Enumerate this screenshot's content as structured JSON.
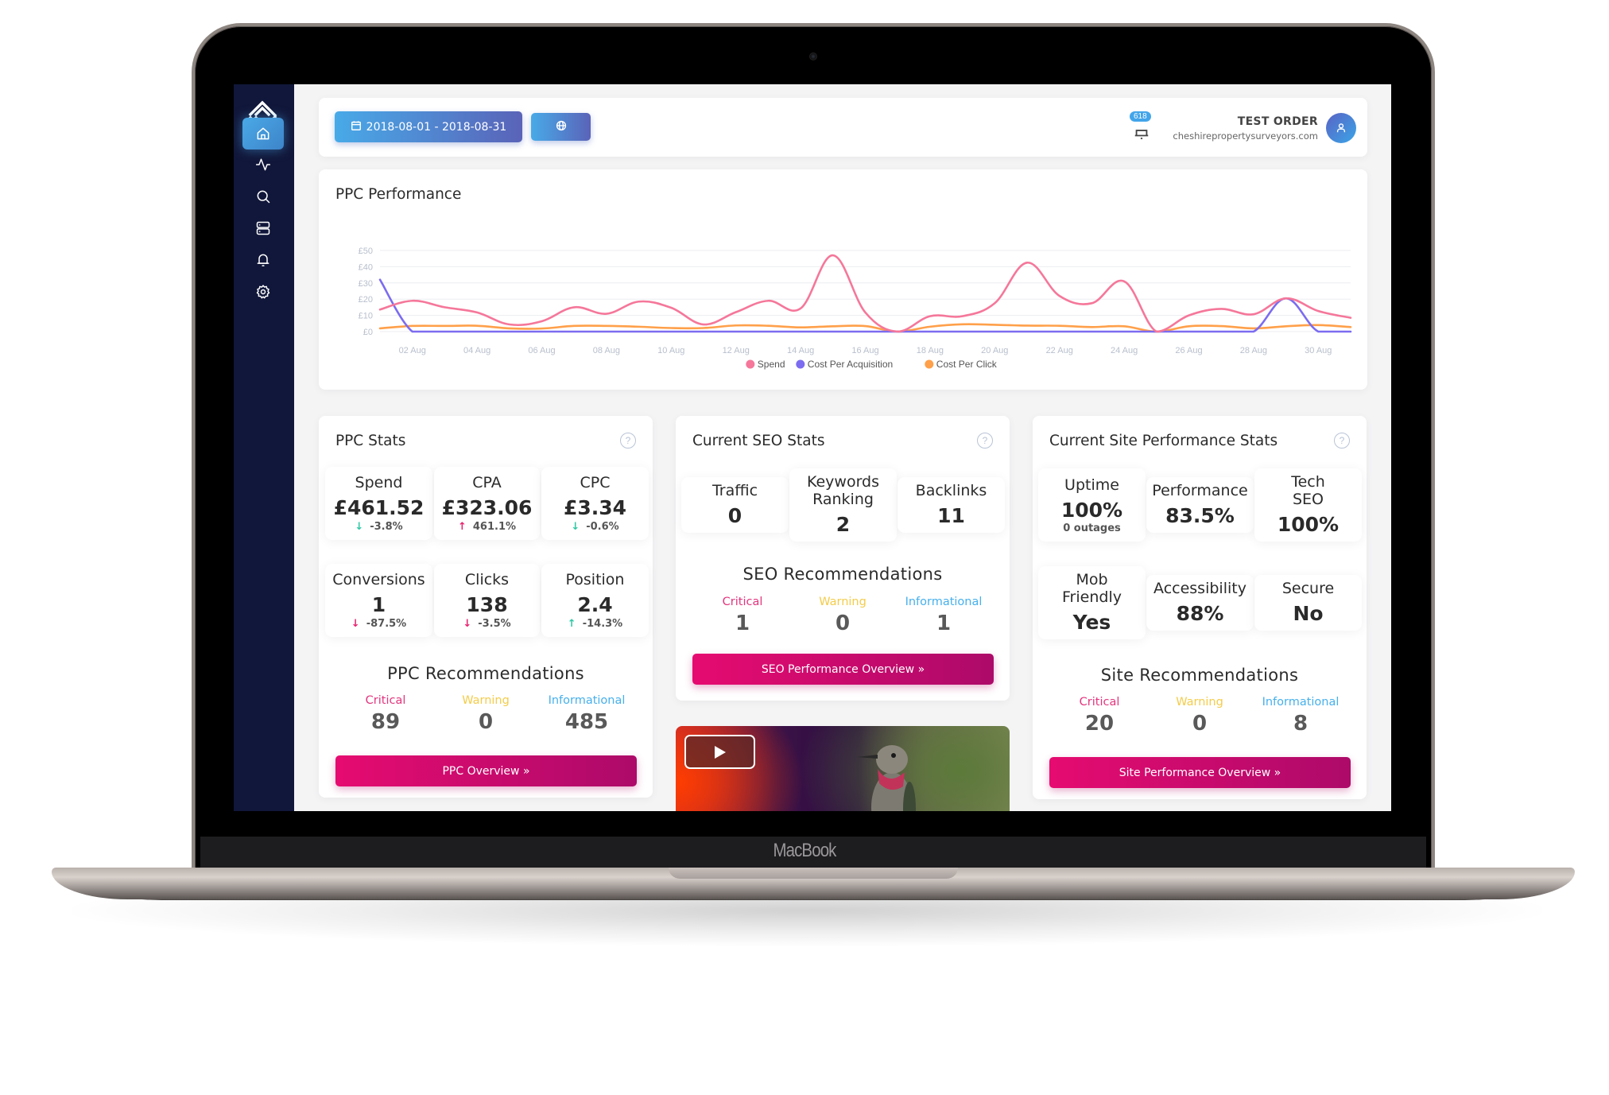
{
  "device": {
    "brand_label": "MacBook"
  },
  "sidebar": {
    "logo": "brand-logo",
    "items": [
      {
        "name": "home",
        "icon": "home-icon",
        "active": true
      },
      {
        "name": "activity",
        "icon": "activity-icon",
        "active": false
      },
      {
        "name": "search",
        "icon": "search-icon",
        "active": false
      },
      {
        "name": "servers",
        "icon": "server-icon",
        "active": false
      },
      {
        "name": "notifications",
        "icon": "bell-icon",
        "active": false
      },
      {
        "name": "settings",
        "icon": "gear-icon",
        "active": false
      }
    ]
  },
  "header": {
    "date_range": "2018-08-01 - 2018-08-31",
    "date_icon": "calendar-icon",
    "globe_icon": "globe-icon",
    "notification_count": "618",
    "user_name": "TEST ORDER",
    "user_site": "cheshirepropertysurveyors.com",
    "avatar_icon": "user-icon"
  },
  "chart_data": {
    "type": "line",
    "title": "PPC Performance",
    "xlabel": "",
    "ylabel": "",
    "x": [
      "01 Aug",
      "02 Aug",
      "03 Aug",
      "04 Aug",
      "05 Aug",
      "06 Aug",
      "07 Aug",
      "08 Aug",
      "09 Aug",
      "10 Aug",
      "11 Aug",
      "12 Aug",
      "13 Aug",
      "14 Aug",
      "15 Aug",
      "16 Aug",
      "17 Aug",
      "18 Aug",
      "19 Aug",
      "20 Aug",
      "21 Aug",
      "22 Aug",
      "23 Aug",
      "24 Aug",
      "25 Aug",
      "26 Aug",
      "27 Aug",
      "28 Aug",
      "29 Aug",
      "30 Aug",
      "31 Aug"
    ],
    "x_tick_labels": [
      "02 Aug",
      "04 Aug",
      "06 Aug",
      "08 Aug",
      "10 Aug",
      "12 Aug",
      "14 Aug",
      "16 Aug",
      "18 Aug",
      "20 Aug",
      "22 Aug",
      "24 Aug",
      "26 Aug",
      "28 Aug",
      "30 Aug"
    ],
    "y_tick_labels": [
      "£0",
      "£10",
      "£20",
      "£30",
      "£40",
      "£50"
    ],
    "ylim": [
      0,
      50
    ],
    "grid": true,
    "legend_position": "bottom-center",
    "series": [
      {
        "name": "Spend",
        "color": "#f5779a",
        "values": [
          13.6,
          19,
          15,
          11.8,
          4.4,
          6.4,
          15,
          11,
          18.5,
          14.7,
          4.4,
          12,
          19,
          14.3,
          47,
          11.8,
          0,
          9.5,
          9.5,
          17.5,
          42.5,
          22,
          17.5,
          31,
          0,
          10,
          14,
          10.7,
          20.5,
          12.7,
          8.5
        ]
      },
      {
        "name": "Cost Per Acquisition",
        "color": "#7b6cf0",
        "values": [
          32,
          0,
          0,
          0,
          0,
          0,
          0,
          0,
          0,
          0,
          0,
          0,
          0,
          0,
          0,
          0,
          0,
          0,
          0,
          0,
          0,
          0,
          0,
          0,
          0,
          0,
          0,
          0,
          20.5,
          0,
          0
        ]
      },
      {
        "name": "Cost Per Click",
        "color": "#ffa04a",
        "values": [
          2,
          3.5,
          3.5,
          3.6,
          2,
          1.9,
          3.5,
          3.5,
          3,
          2.2,
          2.2,
          3.8,
          3.6,
          2.6,
          3.3,
          3.4,
          0,
          3,
          4.5,
          4.2,
          3.7,
          3.6,
          2.8,
          3.3,
          0,
          3.3,
          3.4,
          2,
          3.3,
          4,
          2.8
        ]
      }
    ]
  },
  "ppc_stats": {
    "title": "PPC Stats",
    "help_icon": "?",
    "tiles": [
      {
        "label": "Spend",
        "value": "£461.52",
        "change": "-3.8%",
        "direction": "down",
        "sentiment": "good"
      },
      {
        "label": "CPA",
        "value": "£323.06",
        "change": "461.1%",
        "direction": "up",
        "sentiment": "bad"
      },
      {
        "label": "CPC",
        "value": "£3.34",
        "change": "-0.6%",
        "direction": "down",
        "sentiment": "good"
      },
      {
        "label": "Conversions",
        "value": "1",
        "change": "-87.5%",
        "direction": "down",
        "sentiment": "bad"
      },
      {
        "label": "Clicks",
        "value": "138",
        "change": "-3.5%",
        "direction": "down",
        "sentiment": "bad"
      },
      {
        "label": "Position",
        "value": "2.4",
        "change": "-14.3%",
        "direction": "up",
        "sentiment": "good"
      }
    ],
    "recommendations": {
      "title": "PPC Recommendations",
      "critical_label": "Critical",
      "critical": "89",
      "warning_label": "Warning",
      "warning": "0",
      "info_label": "Informational",
      "info": "485"
    },
    "cta": "PPC Overview  »"
  },
  "seo_stats": {
    "title": "Current SEO Stats",
    "help_icon": "?",
    "tiles": [
      {
        "label": "Traffic",
        "value": "0"
      },
      {
        "label": "Keywords Ranking",
        "value": "2"
      },
      {
        "label": "Backlinks",
        "value": "11"
      }
    ],
    "recommendations": {
      "title": "SEO Recommendations",
      "critical_label": "Critical",
      "critical": "1",
      "warning_label": "Warning",
      "warning": "0",
      "info_label": "Informational",
      "info": "1"
    },
    "cta": "SEO Performance Overview  »"
  },
  "site_stats": {
    "title": "Current Site Performance Stats",
    "help_icon": "?",
    "tiles": [
      {
        "label": "Uptime",
        "value": "100%",
        "sub": "0 outages"
      },
      {
        "label": "Performance",
        "value": "83.5%"
      },
      {
        "label": "Tech SEO",
        "value": "100%"
      },
      {
        "label": "Mob Friendly",
        "value": "Yes"
      },
      {
        "label": "Accessibility",
        "value": "88%"
      },
      {
        "label": "Secure",
        "value": "No"
      }
    ],
    "recommendations": {
      "title": "Site Recommendations",
      "critical_label": "Critical",
      "critical": "20",
      "warning_label": "Warning",
      "warning": "0",
      "info_label": "Informational",
      "info": "8"
    },
    "cta": "Site Performance Overview  »"
  },
  "video": {
    "play_icon": "play-icon",
    "thumbnail": "hummingbird"
  },
  "colors": {
    "sidebar_bg": "#11173a",
    "accent_blue": "#48aae8",
    "cta_pink": "#e60b70",
    "critical": "#e3357d",
    "warning": "#f4cc4a",
    "informational": "#46b0ec",
    "good_arrow": "#2fc8a4",
    "bad_arrow": "#e8246f"
  }
}
